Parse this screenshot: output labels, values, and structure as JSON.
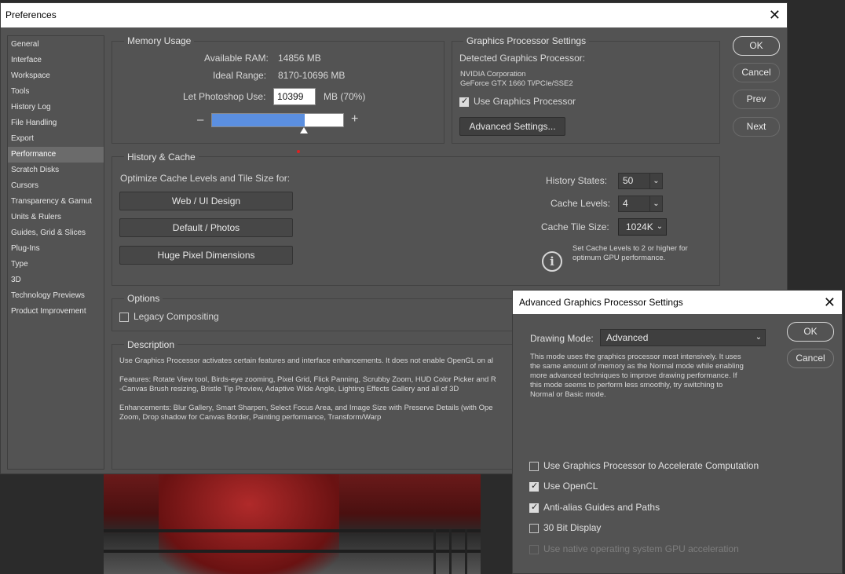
{
  "prefs_window": {
    "title": "Preferences",
    "close_glyph": "✕"
  },
  "sidebar": {
    "items": [
      {
        "label": "General"
      },
      {
        "label": "Interface"
      },
      {
        "label": "Workspace"
      },
      {
        "label": "Tools"
      },
      {
        "label": "History Log"
      },
      {
        "label": "File Handling"
      },
      {
        "label": "Export"
      },
      {
        "label": "Performance"
      },
      {
        "label": "Scratch Disks"
      },
      {
        "label": "Cursors"
      },
      {
        "label": "Transparency & Gamut"
      },
      {
        "label": "Units & Rulers"
      },
      {
        "label": "Guides, Grid & Slices"
      },
      {
        "label": "Plug-Ins"
      },
      {
        "label": "Type"
      },
      {
        "label": "3D"
      },
      {
        "label": "Technology Previews"
      },
      {
        "label": "Product Improvement"
      }
    ],
    "active": "Performance"
  },
  "memory": {
    "title": "Memory Usage",
    "available_label": "Available RAM:",
    "available_value": "14856 MB",
    "ideal_label": "Ideal Range:",
    "ideal_value": "8170-10696 MB",
    "let_label": "Let Photoshop Use:",
    "let_value": "10399",
    "let_suffix": "MB (70%)",
    "minus": "–",
    "plus": "+",
    "slider_fraction": 0.7
  },
  "gpu": {
    "title": "Graphics Processor Settings",
    "detected_label": "Detected Graphics Processor:",
    "vendor": "NVIDIA Corporation",
    "model": "GeForce GTX 1660 Ti/PCIe/SSE2",
    "use_gpu_label": "Use Graphics Processor",
    "use_gpu_checked": true,
    "advanced_button": "Advanced Settings..."
  },
  "side_buttons": {
    "ok": "OK",
    "cancel": "Cancel",
    "prev": "Prev",
    "next": "Next"
  },
  "history_cache": {
    "title": "History & Cache",
    "optimize_label": "Optimize Cache Levels and Tile Size for:",
    "btn_web": "Web / UI Design",
    "btn_default": "Default / Photos",
    "btn_huge": "Huge Pixel Dimensions",
    "history_states_label": "History States:",
    "history_states_value": "50",
    "cache_levels_label": "Cache Levels:",
    "cache_levels_value": "4",
    "tile_size_label": "Cache Tile Size:",
    "tile_size_value": "1024K",
    "info_glyph": "i",
    "hint_line1": "Set Cache Levels to 2 or higher for",
    "hint_line2": "optimum GPU performance."
  },
  "options": {
    "title": "Options",
    "legacy_label": "Legacy Compositing",
    "legacy_checked": false
  },
  "description": {
    "title": "Description",
    "p1": "Use Graphics Processor activates certain features and interface enhancements. It does not enable OpenGL on al",
    "p2a": "Features: Rotate View tool, Birds-eye zooming, Pixel Grid, Flick Panning, Scrubby Zoom, HUD Color Picker and R",
    "p2b": "-Canvas Brush resizing, Bristle Tip Preview, Adaptive Wide Angle, Lighting Effects Gallery and all of 3D",
    "p3a": "Enhancements: Blur Gallery, Smart Sharpen, Select Focus Area, and Image Size with Preserve Details (with Ope",
    "p3b": "Zoom, Drop shadow for Canvas Border, Painting performance, Transform/Warp"
  },
  "advanced_dialog": {
    "title": "Advanced Graphics Processor Settings",
    "close_glyph": "✕",
    "drawing_mode_label": "Drawing Mode:",
    "drawing_mode_value": "Advanced",
    "mode_desc_1": "This mode uses the graphics processor most intensively.  It uses",
    "mode_desc_2": "the same amount of memory as the Normal mode while enabling",
    "mode_desc_3": "more advanced techniques to improve drawing performance.  If",
    "mode_desc_4": "this mode seems to perform less smoothly, try switching to",
    "mode_desc_5": "Normal or Basic mode.",
    "ok": "OK",
    "cancel": "Cancel",
    "opt_accelerate": "Use Graphics Processor to Accelerate Computation",
    "opt_opencl": "Use OpenCL",
    "opt_antialias": "Anti-alias Guides and Paths",
    "opt_30bit": "30 Bit Display",
    "opt_native": "Use native operating system GPU acceleration",
    "accelerate_checked": false,
    "opencl_checked": true,
    "antialias_checked": true,
    "bit30_checked": false,
    "native_checked": false,
    "native_disabled": true
  },
  "colors": {
    "panel": "#535353",
    "slider_fill": "#5b8fe0",
    "marker": "#e02020"
  }
}
